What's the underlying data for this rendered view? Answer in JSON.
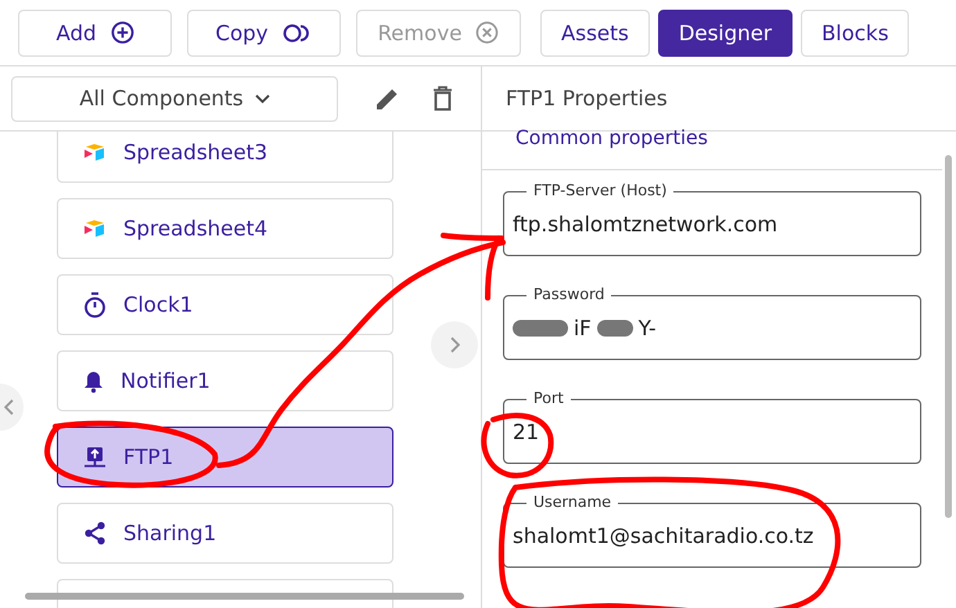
{
  "toolbar": {
    "buttons": [
      {
        "label": "Add",
        "kind": "add",
        "disabled": false
      },
      {
        "label": "Copy",
        "kind": "copy",
        "disabled": false
      },
      {
        "label": "Remove",
        "kind": "remove",
        "disabled": true
      }
    ],
    "tabs": [
      {
        "label": "Assets",
        "selected": false
      },
      {
        "label": "Designer",
        "selected": true
      },
      {
        "label": "Blocks",
        "selected": false
      }
    ]
  },
  "components_panel": {
    "filter": "All Components",
    "items": [
      {
        "label": "Spreadsheet3",
        "kind": "spreadsheet",
        "selected": false
      },
      {
        "label": "Spreadsheet4",
        "kind": "spreadsheet",
        "selected": false
      },
      {
        "label": "Clock1",
        "kind": "clock",
        "selected": false
      },
      {
        "label": "Notifier1",
        "kind": "notifier",
        "selected": false
      },
      {
        "label": "FTP1",
        "kind": "ftp",
        "selected": true
      },
      {
        "label": "Sharing1",
        "kind": "sharing",
        "selected": false
      }
    ]
  },
  "properties_panel": {
    "title": "FTP1 Properties",
    "section": "Common properties",
    "fields": [
      {
        "label": "FTP-Server (Host)",
        "kind": "text",
        "value": "ftp.shalomtznetwork.com"
      },
      {
        "label": "Password",
        "kind": "redacted",
        "parts": [
          "iF",
          "Y-"
        ]
      },
      {
        "label": "Port",
        "kind": "text",
        "value": "21"
      },
      {
        "label": "Username",
        "kind": "text",
        "value": "shalomt1@sachitaradio.co.tz"
      }
    ]
  }
}
